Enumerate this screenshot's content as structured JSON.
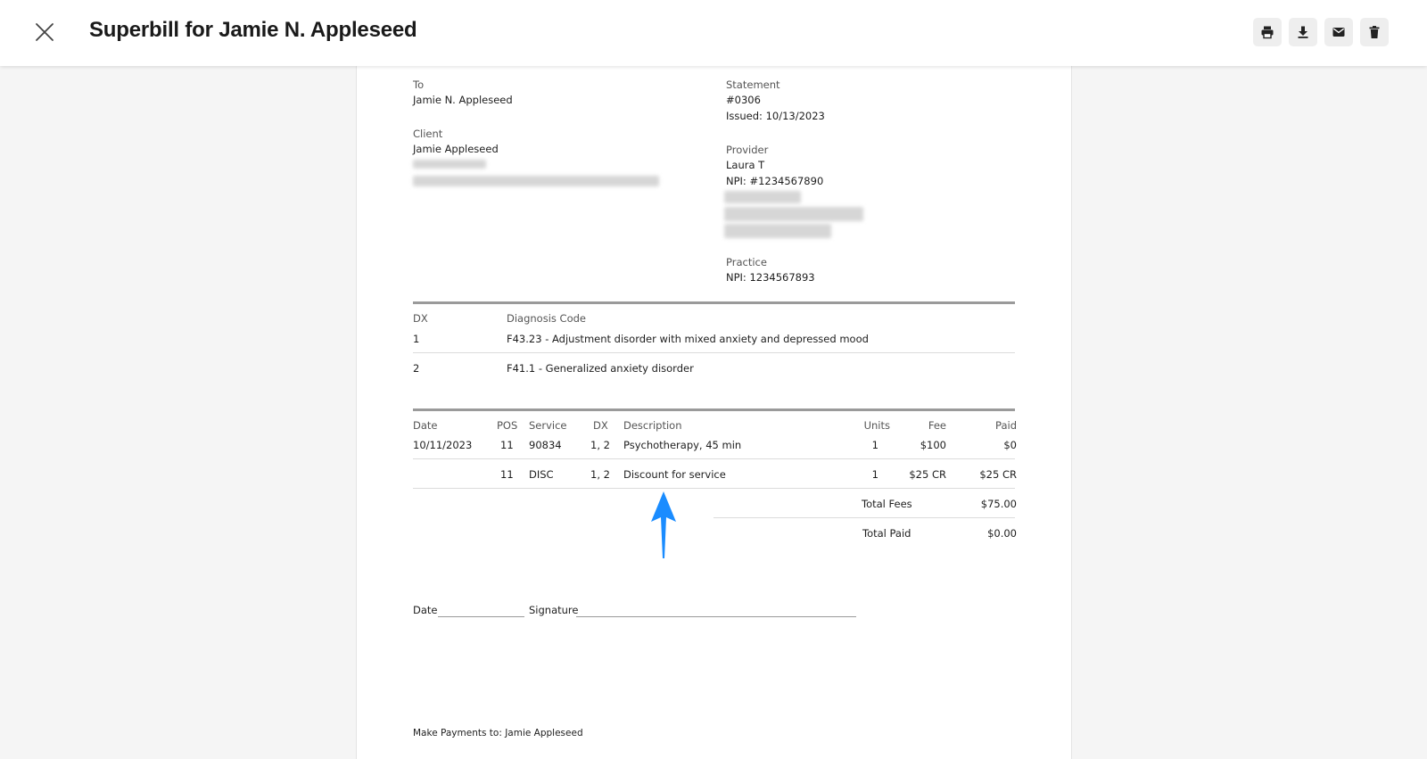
{
  "header": {
    "title": "Superbill for Jamie N. Appleseed"
  },
  "to": {
    "label": "To",
    "name": "Jamie N. Appleseed"
  },
  "client": {
    "label": "Client",
    "name": "Jamie Appleseed"
  },
  "statement": {
    "label": "Statement",
    "number": "#0306",
    "issued": "Issued: 10/13/2023"
  },
  "provider": {
    "label": "Provider",
    "name": "Laura T",
    "npi": "NPI: #1234567890"
  },
  "practice": {
    "label": "Practice",
    "npi": "NPI: 1234567893"
  },
  "diagnosis": {
    "headers": {
      "dx": "DX",
      "code": "Diagnosis Code"
    },
    "rows": [
      {
        "dx": "1",
        "code": "F43.23 - Adjustment disorder with mixed anxiety and depressed mood"
      },
      {
        "dx": "2",
        "code": "F41.1 - Generalized anxiety disorder"
      }
    ]
  },
  "services": {
    "headers": {
      "date": "Date",
      "pos": "POS",
      "service": "Service",
      "dx": "DX",
      "description": "Description",
      "units": "Units",
      "fee": "Fee",
      "paid": "Paid"
    },
    "rows": [
      {
        "date": "10/11/2023",
        "pos": "11",
        "service": "90834",
        "dx": "1, 2",
        "description": "Psychotherapy, 45 min",
        "units": "1",
        "fee": "$100",
        "paid": "$0"
      },
      {
        "date": "",
        "pos": "11",
        "service": "DISC",
        "dx": "1, 2",
        "description": "Discount for service",
        "units": "1",
        "fee": "$25 CR",
        "paid": "$25 CR"
      }
    ]
  },
  "totals": {
    "fees_label": "Total Fees",
    "fees_value": "$75.00",
    "paid_label": "Total Paid",
    "paid_value": "$0.00"
  },
  "signature": {
    "date_label": "Date",
    "signature_label": "Signature"
  },
  "footer": {
    "payments": "Make Payments to: Jamie Appleseed"
  },
  "colors": {
    "annotation_arrow": "#1a8cff",
    "toolbar_button_bg": "#eeeeee"
  },
  "icons": [
    "close-icon",
    "print-icon",
    "download-icon",
    "email-icon",
    "trash-icon"
  ]
}
